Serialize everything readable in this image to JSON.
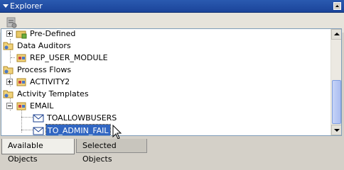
{
  "panel": {
    "title": "Explorer"
  },
  "tree": {
    "items": [
      {
        "label": "Pre-Defined",
        "icon": "folder-lock-icon"
      },
      {
        "label": "Data Auditors",
        "icon": "folder-icon"
      },
      {
        "label": "REP_USER_MODULE",
        "icon": "module-icon"
      },
      {
        "label": "Process Flows",
        "icon": "folder-icon"
      },
      {
        "label": "ACTIVITY2",
        "icon": "module-icon"
      },
      {
        "label": "Activity Templates",
        "icon": "folder-icon"
      },
      {
        "label": "EMAIL",
        "icon": "module-icon"
      },
      {
        "label": "TOALLOWBUSERS",
        "icon": "envelope-icon"
      },
      {
        "label": "TO_ADMIN_FAIL",
        "icon": "envelope-icon",
        "selected": true
      }
    ]
  },
  "tabs": [
    {
      "label": "Available Objects",
      "active": true
    },
    {
      "label": "Selected Objects",
      "active": false
    }
  ],
  "colors": {
    "titlebar": "#1b449a",
    "selection": "#3166c2",
    "scroll_thumb": "#aabdf0"
  }
}
